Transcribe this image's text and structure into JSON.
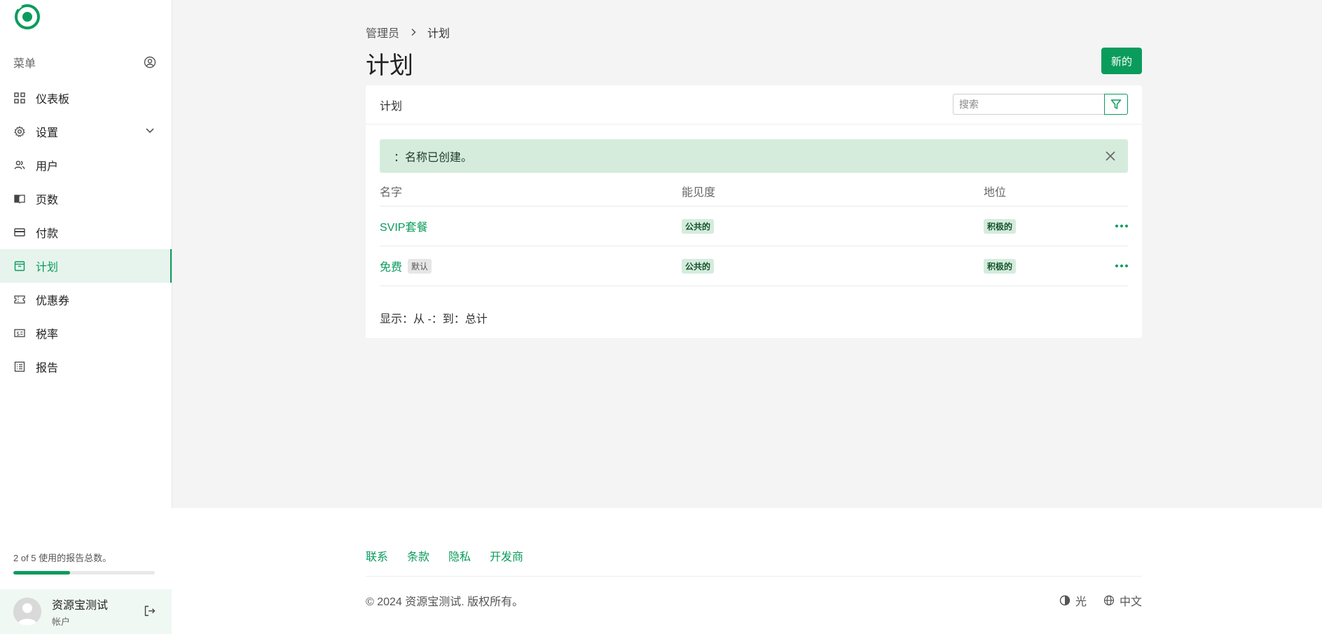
{
  "sidebar": {
    "menu_label": "菜单",
    "items": [
      {
        "label": "仪表板",
        "icon": "dashboard-grid-icon"
      },
      {
        "label": "设置",
        "icon": "gear-icon"
      },
      {
        "label": "用户",
        "icon": "users-icon"
      },
      {
        "label": "页数",
        "icon": "book-icon"
      },
      {
        "label": "付款",
        "icon": "credit-card-icon"
      },
      {
        "label": "计划",
        "icon": "plan-box-icon",
        "active": true
      },
      {
        "label": "优惠券",
        "icon": "ticket-icon"
      },
      {
        "label": "税率",
        "icon": "tax-dollar-icon"
      },
      {
        "label": "报告",
        "icon": "report-list-icon"
      }
    ],
    "usage_text": "2 of 5 使用的报告总数。",
    "usage_fraction": 0.4,
    "user": {
      "name": "资源宝测试",
      "role": "帐户"
    }
  },
  "breadcrumb": {
    "root": "管理员",
    "current": "计划"
  },
  "page_title": "计划",
  "new_button": "新的",
  "card": {
    "title": "计划",
    "search_placeholder": "搜索",
    "alert": "：名称已创建。",
    "columns": [
      "名字",
      "能见度",
      "地位"
    ],
    "rows": [
      {
        "name": "SVIP套餐",
        "default_badge": "",
        "visibility": "公共的",
        "status": "积极的"
      },
      {
        "name": "免费",
        "default_badge": "默认",
        "visibility": "公共的",
        "status": "积极的"
      }
    ],
    "pagination": "显示：从 -：到：总计"
  },
  "footer": {
    "links": [
      "联系",
      "条款",
      "隐私",
      "开发商"
    ],
    "copyright": "© 2024 资源宝测试. 版权所有。",
    "theme": "光",
    "language": "中文"
  },
  "colors": {
    "accent": "#0a9c5c",
    "alert_bg": "#d5ecdd",
    "active_bg": "#e6f4ed"
  }
}
